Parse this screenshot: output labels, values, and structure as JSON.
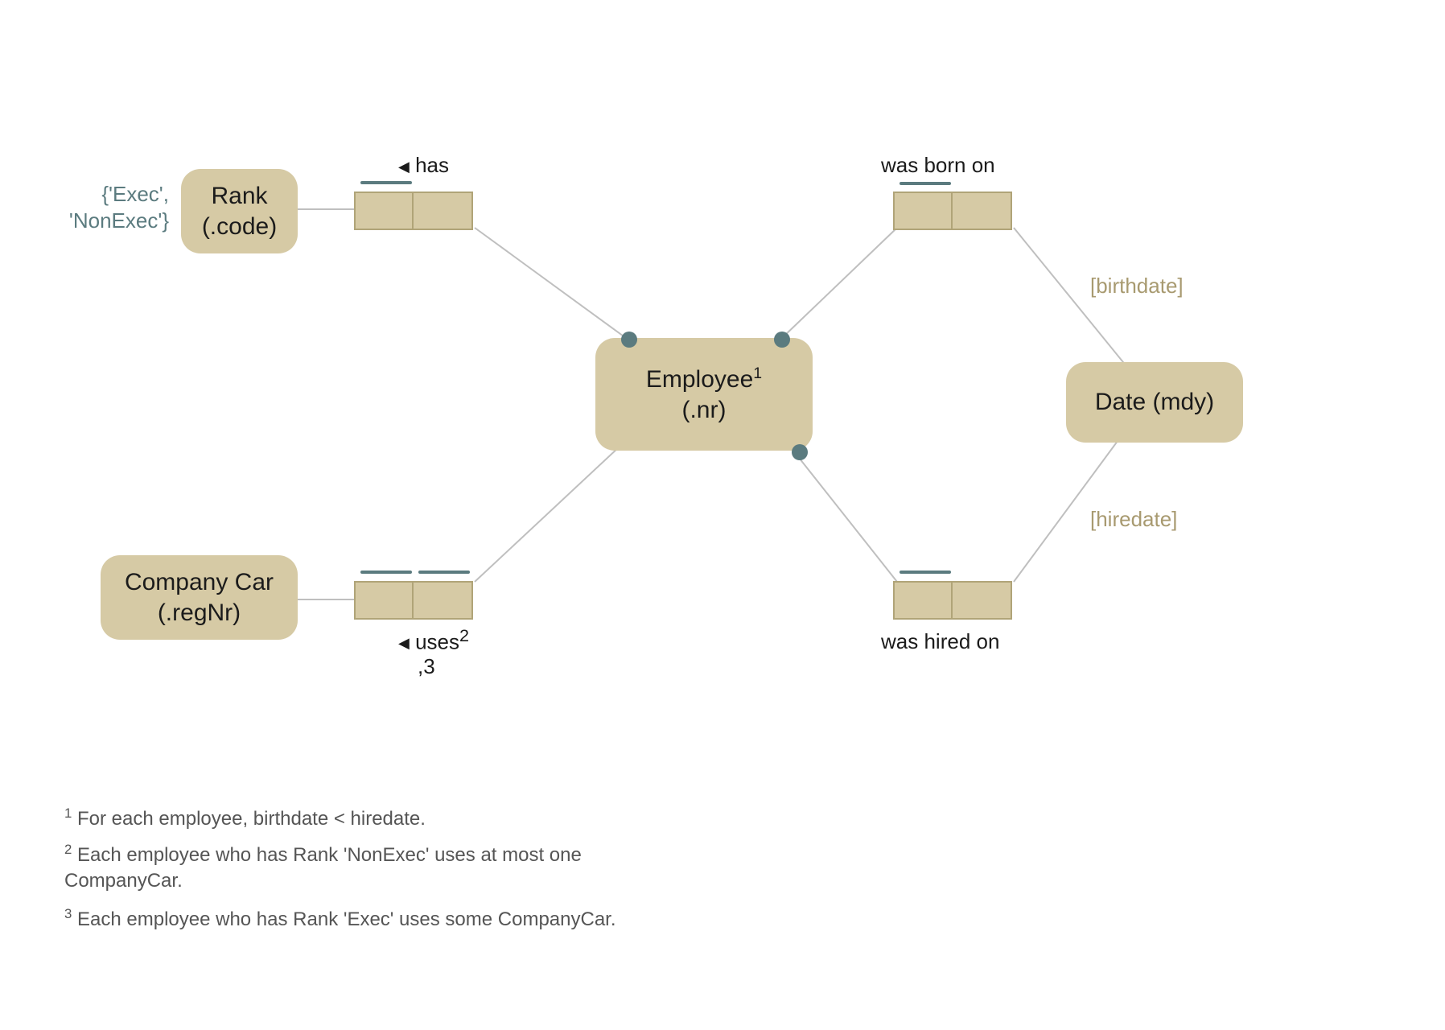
{
  "entities": {
    "rank": {
      "label_line1": "Rank",
      "label_line2": "(.code)"
    },
    "company": {
      "label_line1": "Company Car",
      "label_line2": "(.regNr)"
    },
    "employee": {
      "label": "Employee",
      "sup": "1",
      "line2": "(.nr)"
    },
    "date": {
      "label": "Date (mdy)"
    }
  },
  "facts": {
    "has": {
      "arrow": "◀",
      "label": "has"
    },
    "uses": {
      "arrow": "◀",
      "label": "uses",
      "sup": "2",
      "line2": ",3"
    },
    "born": {
      "label": "was born on"
    },
    "hired": {
      "label": "was hired on"
    }
  },
  "roles": {
    "birthdate": "[birthdate]",
    "hiredate": "[hiredate]"
  },
  "valuelist": {
    "line1": "{'Exec',",
    "line2": "'NonExec'}"
  },
  "footnotes": {
    "f1_sup": "1",
    "f1": " For each employee, birthdate < hiredate.",
    "f2_sup": "2",
    "f2a": " Each employee who has Rank 'NonExec' uses at most one",
    "f2b": "CompanyCar.",
    "f3_sup": "3",
    "f3": " Each employee who has Rank 'Exec' uses some CompanyCar."
  }
}
